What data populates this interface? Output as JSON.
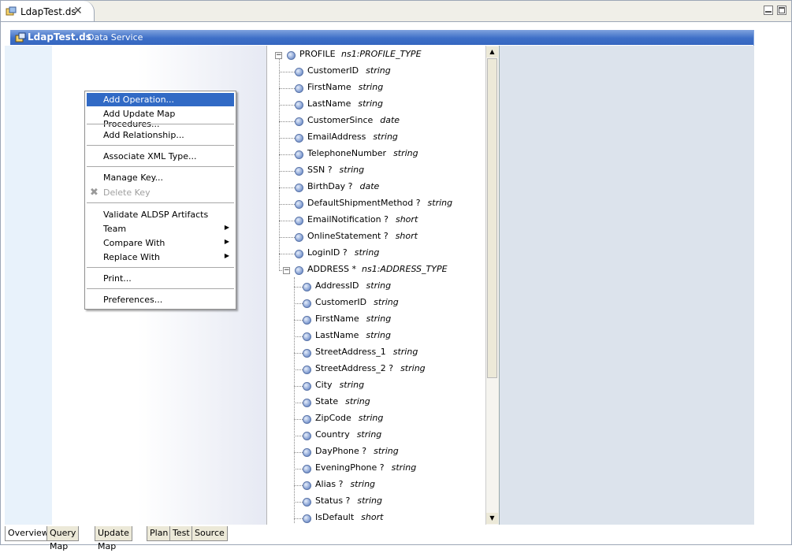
{
  "editor_tab": {
    "title": "LdapTest.ds",
    "close": "✕"
  },
  "service": {
    "name": "LdapTest.ds",
    "type": "Data Service"
  },
  "context_menu": {
    "items": [
      {
        "label": "Add Operation..."
      },
      {
        "label": "Add Update Map Procedures..."
      },
      {
        "label": "Add Relationship..."
      },
      {
        "label": "Associate XML Type..."
      },
      {
        "label": "Manage Key..."
      },
      {
        "label": "Delete Key"
      },
      {
        "label": "Validate ALDSP Artifacts"
      },
      {
        "label": "Team"
      },
      {
        "label": "Compare With"
      },
      {
        "label": "Replace With"
      },
      {
        "label": "Print..."
      },
      {
        "label": "Preferences..."
      }
    ]
  },
  "tree": {
    "root": {
      "name": "PROFILE",
      "type": "ns1:PROFILE_TYPE"
    },
    "profile_fields": [
      {
        "name": "CustomerID",
        "type": "string"
      },
      {
        "name": "FirstName",
        "type": "string"
      },
      {
        "name": "LastName",
        "type": "string"
      },
      {
        "name": "CustomerSince",
        "type": "date"
      },
      {
        "name": "EmailAddress",
        "type": "string"
      },
      {
        "name": "TelephoneNumber",
        "type": "string"
      },
      {
        "name": "SSN  ?",
        "type": "string"
      },
      {
        "name": "BirthDay  ?",
        "type": "date"
      },
      {
        "name": "DefaultShipmentMethod  ?",
        "type": "string"
      },
      {
        "name": "EmailNotification  ?",
        "type": "short"
      },
      {
        "name": "OnlineStatement  ?",
        "type": "short"
      },
      {
        "name": "LoginID  ?",
        "type": "string"
      }
    ],
    "address": {
      "name": "ADDRESS  *",
      "type": "ns1:ADDRESS_TYPE"
    },
    "address_fields": [
      {
        "name": "AddressID",
        "type": "string"
      },
      {
        "name": "CustomerID",
        "type": "string"
      },
      {
        "name": "FirstName",
        "type": "string"
      },
      {
        "name": "LastName",
        "type": "string"
      },
      {
        "name": "StreetAddress_1",
        "type": "string"
      },
      {
        "name": "StreetAddress_2  ?",
        "type": "string"
      },
      {
        "name": "City",
        "type": "string"
      },
      {
        "name": "State",
        "type": "string"
      },
      {
        "name": "ZipCode",
        "type": "string"
      },
      {
        "name": "Country",
        "type": "string"
      },
      {
        "name": "DayPhone  ?",
        "type": "string"
      },
      {
        "name": "EveningPhone  ?",
        "type": "string"
      },
      {
        "name": "Alias  ?",
        "type": "string"
      },
      {
        "name": "Status  ?",
        "type": "string"
      },
      {
        "name": "IsDefault",
        "type": "short"
      }
    ]
  },
  "bottom_tabs": [
    {
      "label": "Overview"
    },
    {
      "label": "Query Map"
    },
    {
      "label": "Update Map"
    },
    {
      "label": "Plan"
    },
    {
      "label": "Test"
    },
    {
      "label": "Source"
    }
  ],
  "colors": {
    "title_bar": "#3e6fc7",
    "menu_selection": "#316ac5"
  }
}
